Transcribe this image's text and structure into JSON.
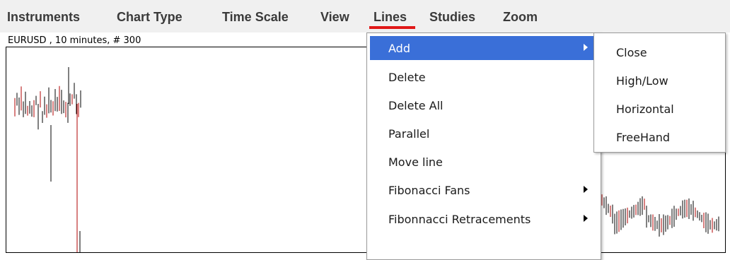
{
  "menubar": {
    "items": [
      "Instruments",
      "Chart Type",
      "Time Scale",
      "View",
      "Lines",
      "Studies",
      "Zoom"
    ],
    "active": "Lines",
    "accent_color": "#e01818"
  },
  "chart": {
    "caption": "EURUSD , 10 minutes, # 300"
  },
  "lines_menu": {
    "items": [
      {
        "label": "Add",
        "has_submenu": true,
        "highlighted": true
      },
      {
        "label": "Delete",
        "has_submenu": false
      },
      {
        "label": "Delete All",
        "has_submenu": false
      },
      {
        "label": "Parallel",
        "has_submenu": false
      },
      {
        "label": "Move line",
        "has_submenu": false
      },
      {
        "label": "Fibonacci Fans",
        "has_submenu": true
      },
      {
        "label": "Fibonnacci Retracements",
        "has_submenu": true
      }
    ],
    "highlight_color": "#3a6fd8"
  },
  "add_submenu": {
    "items": [
      "Close",
      "High/Low",
      "Horizontal",
      "FreeHand"
    ]
  }
}
